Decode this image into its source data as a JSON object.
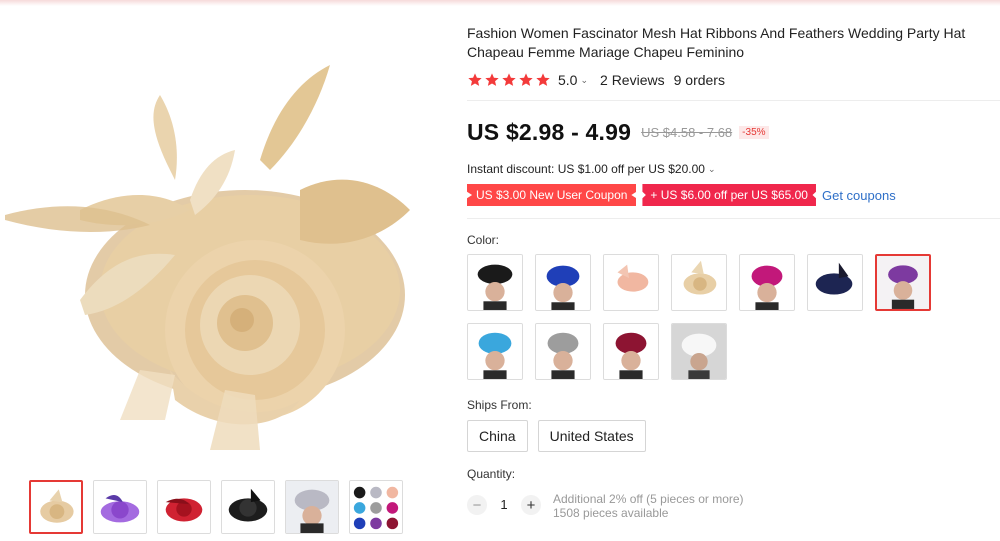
{
  "product": {
    "title": "Fashion Women Fascinator Mesh Hat Ribbons And Feathers Wedding Party Hat Chapeau Femme Mariage Chapeu Feminino",
    "rating": "5.0",
    "reviews": "2 Reviews",
    "orders": "9 orders",
    "price": "US $2.98 - 4.99",
    "original_price": "US $4.58 - 7.68",
    "discount": "-35%"
  },
  "promo": {
    "instant_discount": "Instant discount: US $1.00 off per US $20.00",
    "coupons": [
      {
        "label": "US $3.00 New User Coupon"
      },
      {
        "label": "+ US $6.00 off per US $65.00"
      }
    ],
    "get_coupons": "Get coupons"
  },
  "color": {
    "label": "Color:",
    "options": [
      {
        "icon": "black-fascinator",
        "color": "#1a1a1a"
      },
      {
        "icon": "royal-blue-fascinator",
        "color": "#1f3fb8"
      },
      {
        "icon": "peach-fascinator",
        "color": "#f1b7a1"
      },
      {
        "icon": "champagne-fascinator",
        "color": "#e8cfa6"
      },
      {
        "icon": "magenta-fascinator",
        "color": "#c2187a"
      },
      {
        "icon": "navy-fascinator",
        "color": "#1d2552"
      },
      {
        "icon": "purple-fascinator",
        "color": "#7d3aa0",
        "selected": true
      },
      {
        "icon": "sky-blue-fascinator",
        "color": "#3aa7dd"
      },
      {
        "icon": "grey-fascinator",
        "color": "#9d9d9d"
      },
      {
        "icon": "burgundy-fascinator",
        "color": "#8d1432"
      },
      {
        "icon": "white-fascinator",
        "color": "#f2f2f2"
      }
    ]
  },
  "shipping": {
    "label": "Ships From:",
    "options": [
      "China",
      "United States"
    ]
  },
  "quantity": {
    "label": "Quantity:",
    "value": "1",
    "minus": "−",
    "plus": "+",
    "note1": "Additional 2% off (5 pieces or more)",
    "note2": "1508 pieces available"
  },
  "gallery": {
    "main_color": "#e6cba2",
    "thumbs": [
      {
        "icon": "champagne-hat-thumb",
        "color": "#e6cba2",
        "selected": true
      },
      {
        "icon": "purple-hat-thumb",
        "color": "#9b5bd4"
      },
      {
        "icon": "red-hat-thumb",
        "color": "#c21b2b"
      },
      {
        "icon": "black-hat-thumb",
        "color": "#1a1a1a"
      },
      {
        "icon": "model-grey-hat-thumb",
        "color": "#b9b9c4"
      },
      {
        "icon": "color-collage-thumb",
        "color": "#7d7d9c"
      }
    ]
  },
  "colors": {
    "star": "#f33a3a",
    "accent_red": "#ff4747",
    "link_blue": "#2e6fc8"
  }
}
